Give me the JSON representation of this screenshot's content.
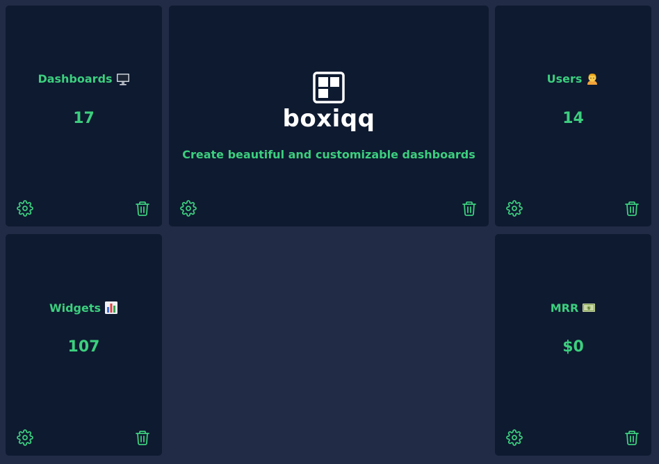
{
  "brand": {
    "name": "boxiqq",
    "tagline": "Create beautiful and customizable dashboards",
    "logo_icon": "boxiqq-logo-icon"
  },
  "cards": [
    {
      "id": "dashboards",
      "title": "Dashboards",
      "emoji_icon": "desktop-computer-icon",
      "value": "17"
    },
    {
      "id": "users",
      "title": "Users",
      "emoji_icon": "person-icon",
      "value": "14"
    },
    {
      "id": "widgets",
      "title": "Widgets",
      "emoji_icon": "bar-chart-icon",
      "value": "107"
    },
    {
      "id": "mrr",
      "title": "MRR",
      "emoji_icon": "dollar-banknote-icon",
      "value": "$0"
    }
  ],
  "actions": {
    "settings_icon": "gear-icon",
    "delete_icon": "trash-icon"
  },
  "colors": {
    "background": "#212b45",
    "card": "#0e1a30",
    "accent": "#3ccf7e",
    "brand_text": "#ffffff"
  }
}
